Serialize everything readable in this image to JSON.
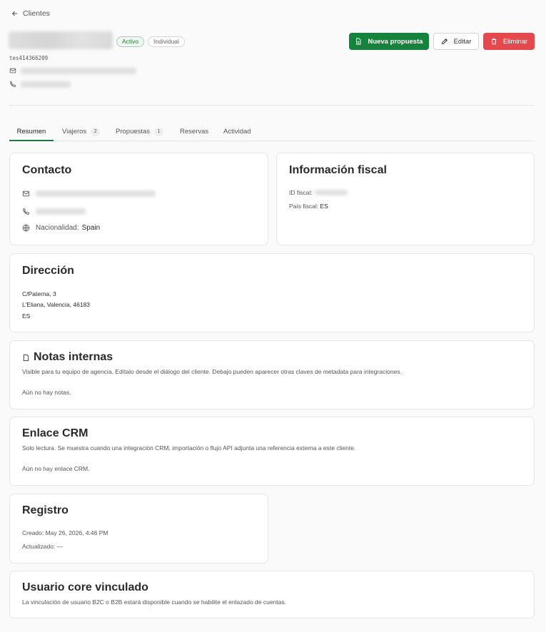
{
  "nav": {
    "back_label": "Clientes"
  },
  "client": {
    "status_badge": "Activo",
    "type_badge": "Individual",
    "id": "tes414366209"
  },
  "actions": {
    "new_proposal": "Nueva propuesta",
    "edit": "Editar",
    "delete": "Eliminar"
  },
  "tabs": [
    {
      "label": "Resumen",
      "count": ""
    },
    {
      "label": "Viajeros",
      "count": "2"
    },
    {
      "label": "Propuestas",
      "count": "1"
    },
    {
      "label": "Reservas",
      "count": ""
    },
    {
      "label": "Actividad",
      "count": ""
    }
  ],
  "contact": {
    "title": "Contacto",
    "nationality_label": "Nacionalidad:",
    "nationality_value": "Spain"
  },
  "fiscal": {
    "title": "Información fiscal",
    "id_label": "ID fiscal:",
    "country_label": "País fiscal:",
    "country_value": "ES"
  },
  "address": {
    "title": "Dirección",
    "line1": "C/Paterna, 3",
    "line2": "L'Eliana, Valencia, 46183",
    "line3": "ES"
  },
  "notes": {
    "title": "Notas internas",
    "description": "Visible para tu equipo de agencia. Edítalo desde el diálogo del cliente. Debajo pueden aparecer otras claves de metadata para integraciones.",
    "empty": "Aún no hay notas."
  },
  "crm": {
    "title": "Enlace CRM",
    "description": "Solo lectura. Se muestra cuando una integración CRM, importación o flujo API adjunta una referencia externa a este cliente.",
    "empty": "Aún no hay enlace CRM."
  },
  "registry": {
    "title": "Registro",
    "created": "Creado: May 26, 2026, 4:46 PM",
    "updated": "Actualizado: —"
  },
  "core_user": {
    "title": "Usuario core vinculado",
    "description": "La vinculación de usuario B2C o B2B estará disponible cuando se habilite el enlazado de cuentas."
  },
  "colors": {
    "primary": "#15833b",
    "danger": "#e5484d",
    "active_badge": "#1f7a3a"
  },
  "icons": [
    "arrow-left-icon",
    "file-icon",
    "pencil-icon",
    "trash-icon",
    "mail-icon",
    "phone-icon",
    "globe-icon",
    "note-icon"
  ]
}
